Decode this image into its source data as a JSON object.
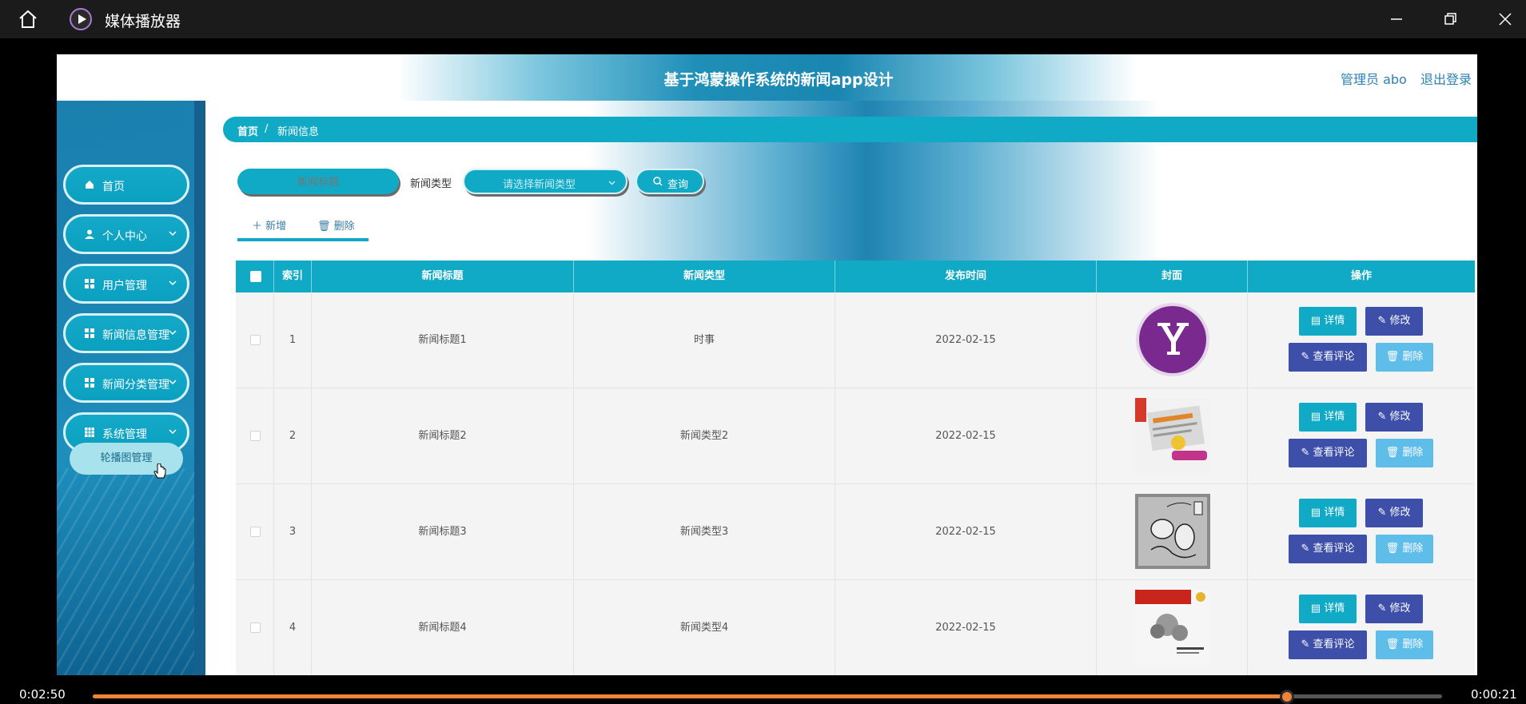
{
  "player": {
    "app_title": "媒体播放器",
    "time_elapsed": "0:02:50",
    "time_remaining": "0:00:21",
    "progress": 0.885,
    "accent_color": "#f0833a"
  },
  "header": {
    "title": "基于鸿蒙操作系统的新闻app设计",
    "admin": "管理员 abo",
    "logout": "退出登录"
  },
  "sidebar": {
    "items": [
      {
        "label": "首页",
        "icon": "home-icon"
      },
      {
        "label": "个人中心",
        "icon": "user-icon"
      },
      {
        "label": "用户管理",
        "icon": "grid-icon"
      },
      {
        "label": "新闻信息管理",
        "icon": "grid-icon"
      },
      {
        "label": "新闻分类管理",
        "icon": "grid-icon"
      },
      {
        "label": "系统管理",
        "icon": "table-icon"
      }
    ],
    "submenu": {
      "label": "轮播图管理"
    }
  },
  "breadcrumb": {
    "home": "首页",
    "separator": "/",
    "current": "新闻信息"
  },
  "search": {
    "title_placeholder": "新闻标题",
    "type_label": "新闻类型",
    "type_placeholder": "请选择新闻类型",
    "query_label": "查询"
  },
  "toolbar": {
    "add_label": "新增",
    "delete_label": "删除"
  },
  "table": {
    "headers": [
      "索引",
      "新闻标题",
      "新闻类型",
      "发布时间",
      "封面",
      "操作"
    ],
    "rows": [
      {
        "index": "1",
        "title": "新闻标题1",
        "type": "时事",
        "date": "2022-02-15",
        "cover": "yahoo-logo"
      },
      {
        "index": "2",
        "title": "新闻标题2",
        "type": "新闻类型2",
        "date": "2022-02-15",
        "cover": "magazine-cover"
      },
      {
        "index": "3",
        "title": "新闻标题3",
        "type": "新闻类型3",
        "date": "2022-02-15",
        "cover": "cartoon-sketch"
      },
      {
        "index": "4",
        "title": "新闻标题4",
        "type": "新闻类型4",
        "date": "2022-02-15",
        "cover": "magazine-cover"
      }
    ],
    "actions": {
      "detail": "详情",
      "edit": "修改",
      "comments": "查看评论",
      "delete": "删除"
    }
  },
  "colors": {
    "primary": "#11aac6",
    "dark_blue": "#3d4fa8",
    "light_blue": "#5fbdea"
  }
}
